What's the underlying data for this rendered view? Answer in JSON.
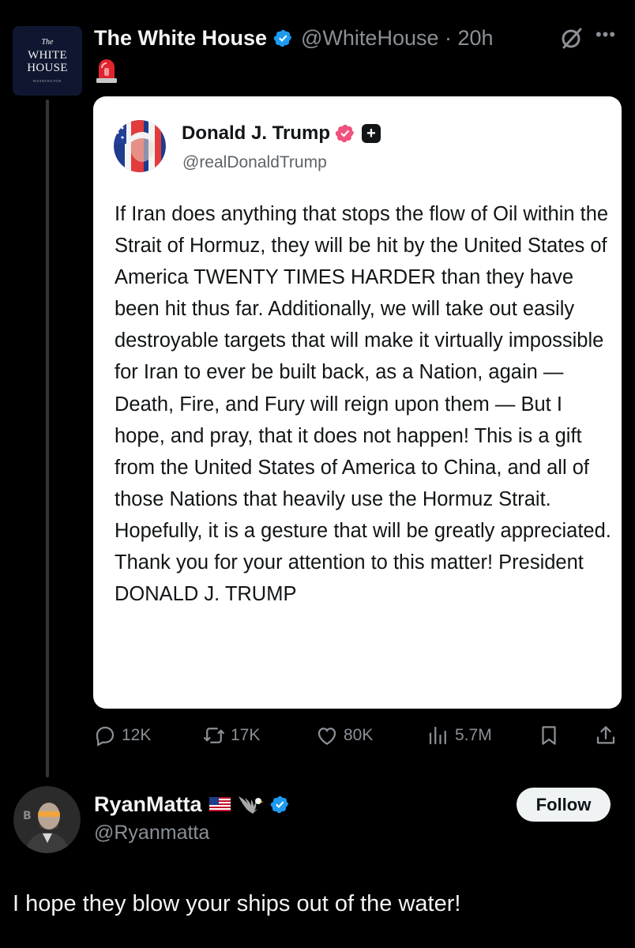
{
  "tweet": {
    "avatar_lines": [
      "The",
      "WHITE",
      "HOUSE",
      "WASHINGTON"
    ],
    "author_name": "The White House",
    "handle_time": "@WhiteHouse · 20h",
    "icons": [
      "verified-badge-icon",
      "siren-icon",
      "grok-icon",
      "more-icon"
    ]
  },
  "quoted": {
    "author_name": "Donald J. Trump",
    "handle": "@realDonaldTrump",
    "body": "If Iran does anything that stops the flow of Oil within the Strait of Hormuz, they will be hit by the United States of America TWENTY TIMES HARDER than they have been hit thus far. Additionally, we will take out easily destroyable targets that will make it virtually impossible for Iran to ever be built back, as a Nation, again — Death, Fire, and Fury will reign upon them — But I hope, and pray, that it does not happen! This is a gift from the United States of America to China, and all of those Nations that heavily use the Hormuz Strait. Hopefully, it is a gesture that will be greatly appreciated. Thank you for your attention to this matter! President DONALD J. TRUMP",
    "plus_symbol": "+",
    "badge_color": "#f0517d"
  },
  "actions": {
    "replies": "12K",
    "reposts": "17K",
    "likes": "80K",
    "views": "5.7M"
  },
  "reply": {
    "author_name": "RyanMatta",
    "handle": "@Ryanmatta",
    "follow_label": "Follow",
    "body": "I hope they blow your ships out of the water!",
    "avatar_letter": "B"
  },
  "colors": {
    "background": "#000000",
    "verified_blue": "#1d9bf0",
    "muted_text": "#8a9096"
  }
}
